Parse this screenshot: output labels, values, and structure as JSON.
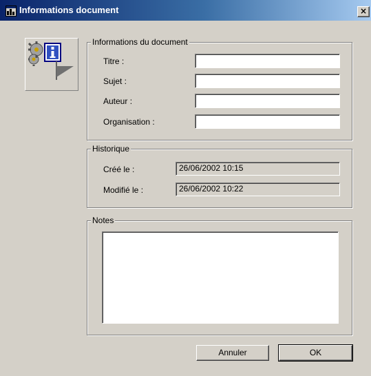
{
  "window": {
    "title": "Informations document",
    "close_glyph": "×"
  },
  "icons": {
    "title": "window-icon",
    "document": "document-info-icon"
  },
  "doc_info": {
    "group_label": "Informations du document",
    "title_label": "Titre :",
    "title_value": "",
    "subject_label": "Sujet :",
    "subject_value": "",
    "author_label": "Auteur :",
    "author_value": "",
    "organisation_label": "Organisation :",
    "organisation_value": ""
  },
  "history": {
    "group_label": "Historique",
    "created_label": "Créé le :",
    "created_value": "26/06/2002 10:15",
    "modified_label": "Modifié le :",
    "modified_value": "26/06/2002 10:22"
  },
  "notes": {
    "group_label": "Notes",
    "value": ""
  },
  "buttons": {
    "cancel": "Annuler",
    "ok": "OK"
  }
}
